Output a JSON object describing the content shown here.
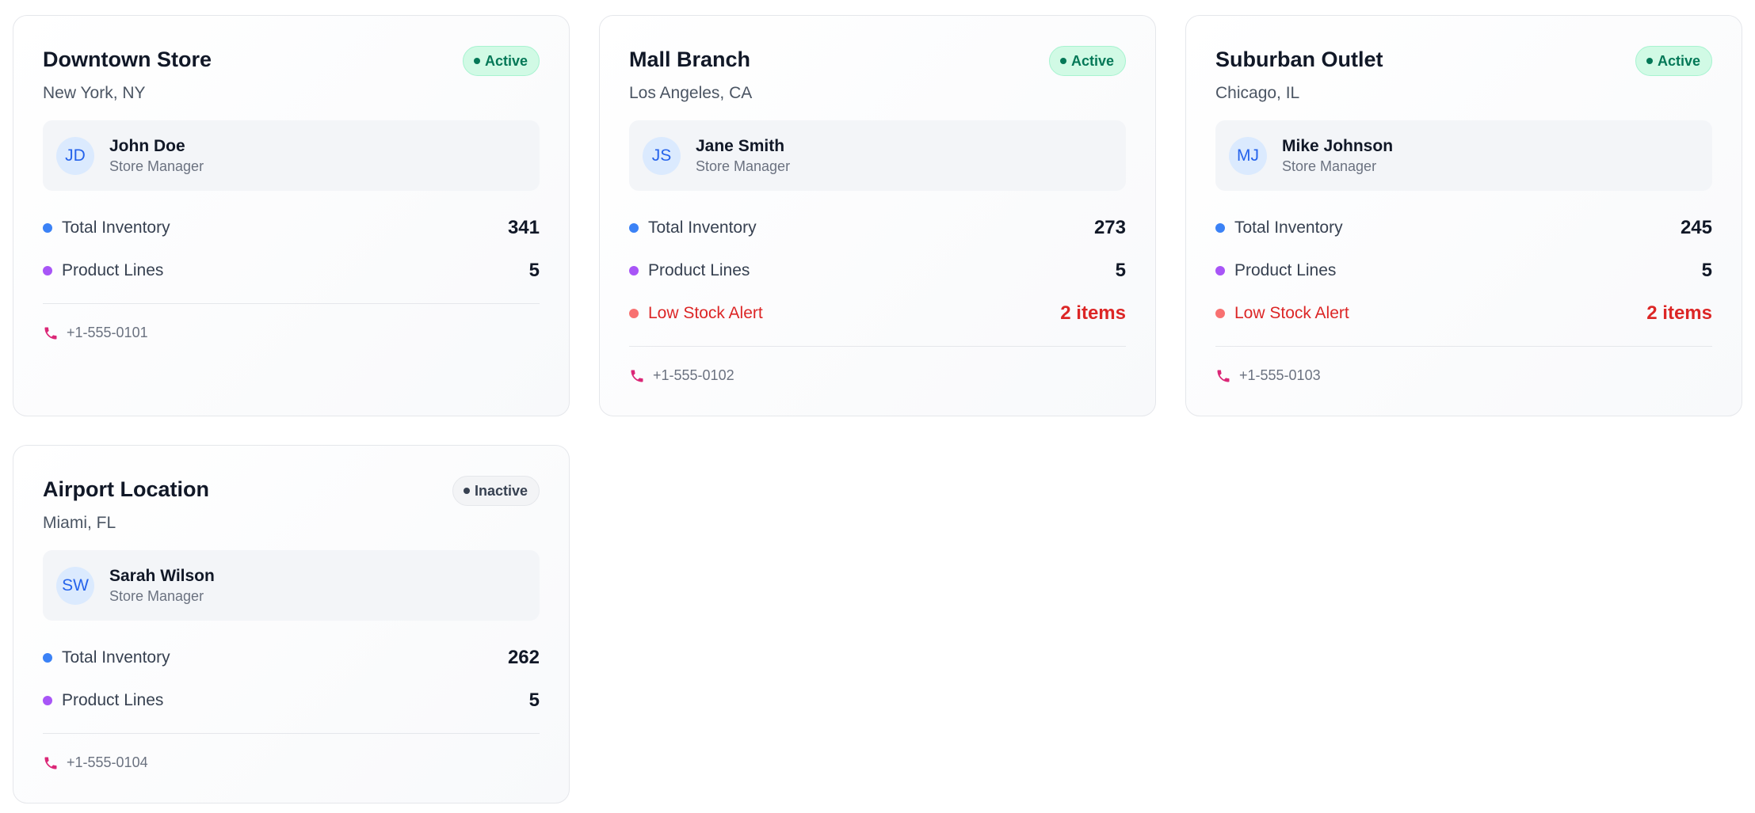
{
  "colors": {
    "inventory_dot": "#3b82f6",
    "product_lines_dot": "#a855f7",
    "alert_dot": "#f87171",
    "alert_text": "#dc2626",
    "active_badge_bg": "#d1fae5",
    "active_badge_text": "#047857",
    "inactive_badge_bg": "#f3f4f6",
    "phone_icon": "#db2777"
  },
  "stores": [
    {
      "name": "Downtown Store",
      "status": "Active",
      "location": "New York, NY",
      "manager": {
        "initials": "JD",
        "name": "John Doe",
        "role": "Store Manager"
      },
      "stats": {
        "inventory_label": "Total Inventory",
        "inventory_value": "341",
        "lines_label": "Product Lines",
        "lines_value": "5"
      },
      "phone": "+1-555-0101"
    },
    {
      "name": "Mall Branch",
      "status": "Active",
      "location": "Los Angeles, CA",
      "manager": {
        "initials": "JS",
        "name": "Jane Smith",
        "role": "Store Manager"
      },
      "stats": {
        "inventory_label": "Total Inventory",
        "inventory_value": "273",
        "lines_label": "Product Lines",
        "lines_value": "5",
        "alert_label": "Low Stock Alert",
        "alert_value": "2 items"
      },
      "phone": "+1-555-0102"
    },
    {
      "name": "Suburban Outlet",
      "status": "Active",
      "location": "Chicago, IL",
      "manager": {
        "initials": "MJ",
        "name": "Mike Johnson",
        "role": "Store Manager"
      },
      "stats": {
        "inventory_label": "Total Inventory",
        "inventory_value": "245",
        "lines_label": "Product Lines",
        "lines_value": "5",
        "alert_label": "Low Stock Alert",
        "alert_value": "2 items"
      },
      "phone": "+1-555-0103"
    },
    {
      "name": "Airport Location",
      "status": "Inactive",
      "location": "Miami, FL",
      "manager": {
        "initials": "SW",
        "name": "Sarah Wilson",
        "role": "Store Manager"
      },
      "stats": {
        "inventory_label": "Total Inventory",
        "inventory_value": "262",
        "lines_label": "Product Lines",
        "lines_value": "5"
      },
      "phone": "+1-555-0104"
    }
  ]
}
